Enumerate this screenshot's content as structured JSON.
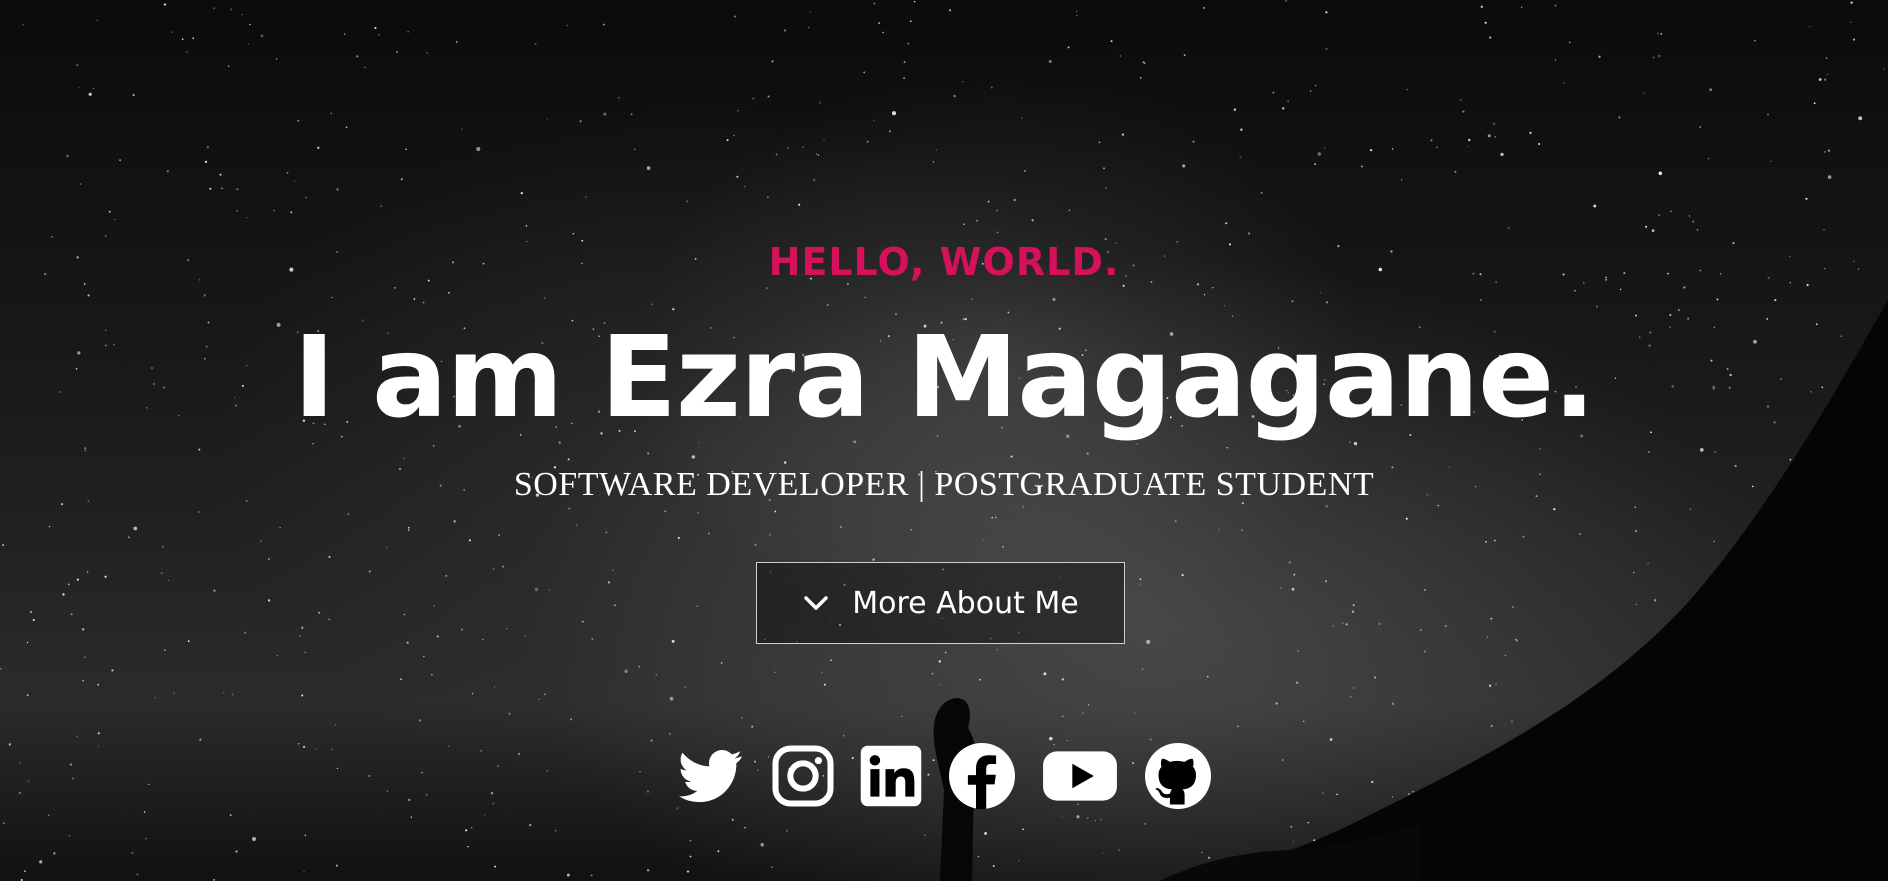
{
  "hero": {
    "greeting": "HELLO, WORLD.",
    "headline": "I am Ezra Magagane.",
    "subtitle": "SOFTWARE DEVELOPER | POSTGRADUATE STUDENT",
    "cta_label": "More About Me",
    "cta_icon": "chevron-down-icon"
  },
  "socials": [
    {
      "icon": "twitter-icon"
    },
    {
      "icon": "instagram-icon"
    },
    {
      "icon": "linkedin-icon"
    },
    {
      "icon": "facebook-icon"
    },
    {
      "icon": "youtube-icon"
    },
    {
      "icon": "github-icon"
    }
  ],
  "colors": {
    "accent": "#d6115c",
    "text": "#ffffff",
    "background": "#000000"
  }
}
